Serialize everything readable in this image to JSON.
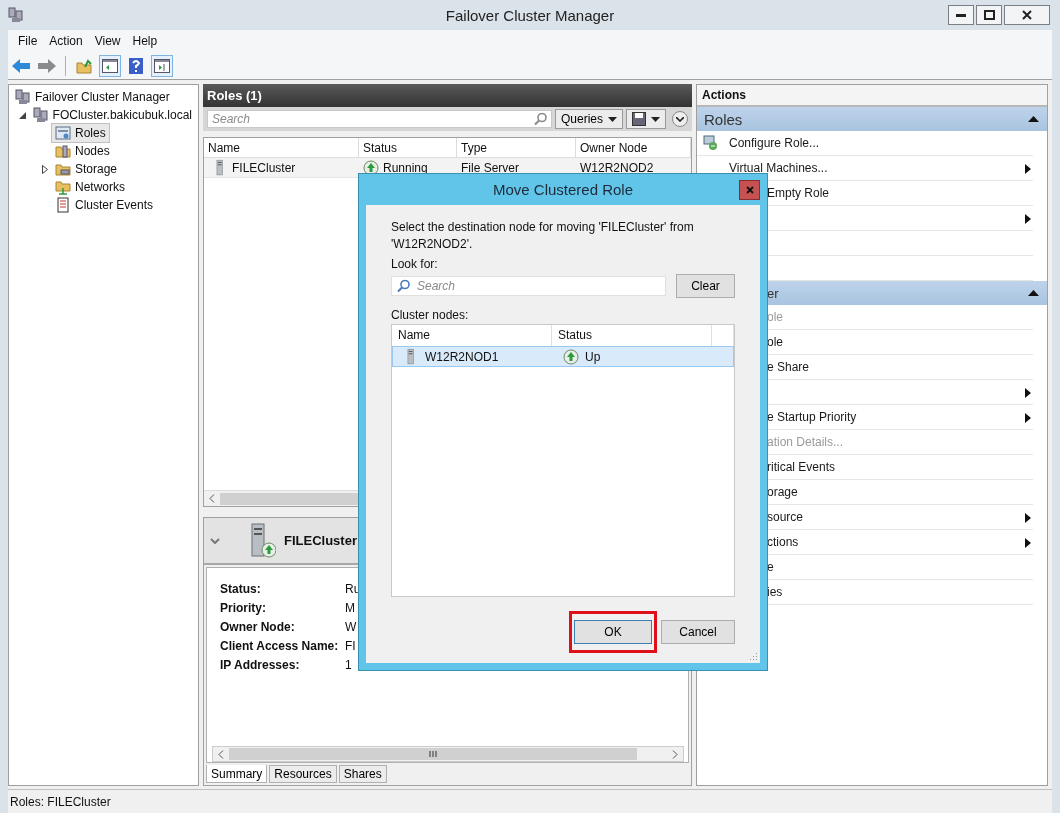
{
  "window": {
    "title": "Failover Cluster Manager"
  },
  "menu": [
    "File",
    "Action",
    "View",
    "Help"
  ],
  "tree": [
    {
      "label": "Failover Cluster Manager",
      "selected": false,
      "children": [
        {
          "label": "FOCluster.bakicubuk.local",
          "selected": false,
          "expanded": true,
          "children": [
            {
              "label": "Roles",
              "selected": true
            },
            {
              "label": "Nodes",
              "selected": false
            },
            {
              "label": "Storage",
              "selected": false,
              "expanded": false
            },
            {
              "label": "Networks",
              "selected": false
            },
            {
              "label": "Cluster Events",
              "selected": false
            }
          ]
        }
      ]
    }
  ],
  "roles": {
    "title": "Roles (1)",
    "search": {
      "placeholder": "Search"
    },
    "queries": "Queries",
    "columns": [
      "Name",
      "Status",
      "Type",
      "Owner Node"
    ],
    "rows": [
      {
        "name": "FILECluster",
        "status": "Running",
        "type": "File Server",
        "owner": "W12R2NOD2",
        "selected": false
      }
    ]
  },
  "details": {
    "title": "FILECluster",
    "fields": [
      {
        "label": "Status:",
        "value": "Ru"
      },
      {
        "label": "Priority:",
        "value": "M"
      },
      {
        "label": "Owner Node:",
        "value": "W"
      },
      {
        "label": "Client Access Name:",
        "value": "FI"
      },
      {
        "label": "IP Addresses:",
        "value": "1"
      }
    ],
    "tabs": [
      {
        "label": "Summary",
        "selected": true
      },
      {
        "label": "Resources",
        "selected": false
      },
      {
        "label": "Shares",
        "selected": false
      }
    ]
  },
  "actions": {
    "title": "Actions",
    "groups": [
      {
        "title": "Roles",
        "covered": false,
        "items": [
          {
            "label": "Configure Role...",
            "submenu": false,
            "covered": false,
            "disabled": false
          },
          {
            "label": "Virtual Machines...",
            "submenu": true,
            "covered": false,
            "disabled": false
          },
          {
            "label": "Empty Role",
            "submenu": false,
            "covered": true,
            "disabled": false
          },
          {
            "submenu": true
          },
          {
            "submenu": false
          },
          {
            "submenu": false
          }
        ]
      },
      {
        "title": "er",
        "covered": true,
        "items": [
          {
            "label": "ole",
            "submenu": false,
            "covered": true,
            "disabled": true
          },
          {
            "label": "ole",
            "submenu": false,
            "covered": true,
            "disabled": false
          },
          {
            "label": "e Share",
            "submenu": false,
            "covered": true,
            "disabled": false
          },
          {
            "submenu": true,
            "covered": true,
            "disabled": false
          },
          {
            "label": "e Startup Priority",
            "submenu": true,
            "covered": true,
            "disabled": false
          },
          {
            "label": "ation Details...",
            "submenu": false,
            "covered": true,
            "disabled": true
          },
          {
            "label": "ritical Events",
            "submenu": false,
            "covered": true,
            "disabled": false
          },
          {
            "label": "orage",
            "submenu": false,
            "covered": true,
            "disabled": false
          },
          {
            "label": "source",
            "submenu": true,
            "covered": true,
            "disabled": false
          },
          {
            "label": "ctions",
            "submenu": true,
            "covered": true,
            "disabled": false
          },
          {
            "label": "e",
            "submenu": false,
            "covered": true,
            "disabled": false
          },
          {
            "label": "ies",
            "submenu": false,
            "covered": true,
            "disabled": false
          }
        ]
      }
    ]
  },
  "status_bar": "Roles:  FILECluster",
  "dialog": {
    "title": "Move Clustered Role",
    "message": "Select the destination node for moving 'FILECluster' from 'W12R2NOD2'.",
    "look_for": "Look for:",
    "search": {
      "placeholder": "Search"
    },
    "clear": "Clear",
    "nodes_label": "Cluster nodes:",
    "columns": [
      "Name",
      "Status"
    ],
    "nodes": [
      {
        "name": "W12R2NOD1",
        "status": "Up",
        "selected": true
      }
    ],
    "buttons": [
      {
        "label": "OK",
        "highlighted": true
      },
      {
        "label": "Cancel",
        "highlighted": false
      }
    ]
  }
}
